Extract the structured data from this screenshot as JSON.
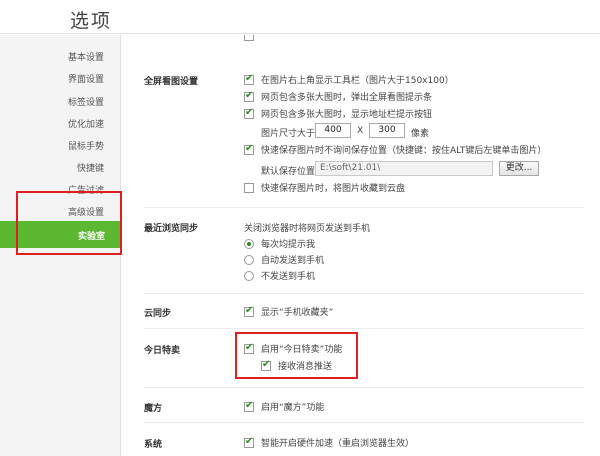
{
  "window": {
    "title": "选项"
  },
  "sidebar": {
    "items": [
      {
        "label": "基本设置"
      },
      {
        "label": "界面设置"
      },
      {
        "label": "标签设置"
      },
      {
        "label": "优化加速"
      },
      {
        "label": "鼠标手势"
      },
      {
        "label": "快捷键"
      },
      {
        "label": "广告过滤"
      },
      {
        "label": "高级设置"
      },
      {
        "label": "实验室"
      }
    ],
    "active_index": 8
  },
  "fullscreen": {
    "title": "全屏看图设置",
    "show_toolbar": {
      "label": "在图片右上角显示工具栏（图片大于150x100）",
      "checked": true
    },
    "popup_bar": {
      "label": "网页包含多张大图时，弹出全屏看图提示条",
      "checked": true
    },
    "addr_button": {
      "label": "网页包含多张大图时，显示地址栏提示按钮",
      "checked": true
    },
    "size": {
      "prefix": "图片尺寸大于",
      "width": "400",
      "sep": "X",
      "height": "300",
      "unit": "像素"
    },
    "quick_save": {
      "label": "快速保存图片时不询问保存位置（快捷键：按住ALT键后左键单击图片）",
      "checked": true
    },
    "save_location": {
      "label": "默认保存位置：",
      "path": "E:\\soft\\21.01\\",
      "change_button": "更改..."
    },
    "save_cloud": {
      "label": "快速保存图片时，将图片收藏到云盘",
      "checked": false
    }
  },
  "sync": {
    "title": "最近浏览同步",
    "desc": "关闭浏览器时将网页发送到手机",
    "options": [
      {
        "label": "每次均提示我",
        "selected": true
      },
      {
        "label": "自动发送到手机",
        "selected": false
      },
      {
        "label": "不发送到手机",
        "selected": false
      }
    ]
  },
  "cloud_sync": {
    "title": "云同步",
    "show_favorites": {
      "label": "显示“手机收藏夹”",
      "checked": true
    }
  },
  "daily_deals": {
    "title": "今日特卖",
    "enable": {
      "label": "启用“今日特卖”功能",
      "checked": true
    },
    "push": {
      "label": "接收消息推送",
      "checked": true
    }
  },
  "mofang": {
    "title": "魔方",
    "enable": {
      "label": "启用“魔方”功能",
      "checked": true
    }
  },
  "system": {
    "title": "系统",
    "hw_accel": {
      "label": "智能开启硬件加速（重启浏览器生效）",
      "checked": true
    }
  },
  "colors": {
    "accent": "#5cb830",
    "highlight": "#e02020",
    "check": "#2e8b22"
  }
}
